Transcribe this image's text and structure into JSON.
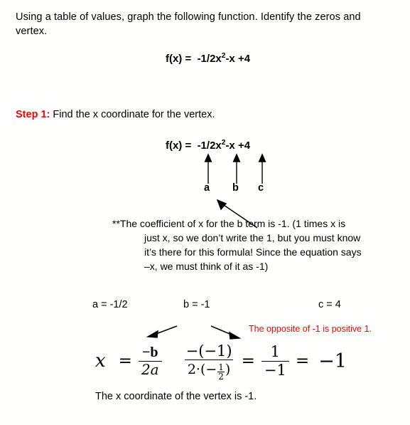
{
  "slide": {
    "background_color": "#fffffd",
    "accent_color": "#ff0000",
    "text_color": "#000000"
  },
  "intro": {
    "text": "Using a table of values, graph the following function.   Identify the zeros and vertex."
  },
  "equation_main": {
    "lhs": "f(x) =",
    "rhs_a": "-1/2x",
    "rhs_sq": "2",
    "rhs_b": "-x +4"
  },
  "step": {
    "label": "Step 1:",
    "text": "Find the x coordinate for the vertex."
  },
  "equation_second": {
    "lhs": "f(x) =",
    "rhs_a": "-1/2x",
    "rhs_sq": "2",
    "rhs_b": "-x +4"
  },
  "coefficient_labels": {
    "a": "a",
    "b": "b",
    "c": "c"
  },
  "note": {
    "line1": "**The coefficient of x for the b term is -1.  (1 times x is",
    "line2": "just x, so we don’t write the 1, but you must know",
    "line3": "it’s there for this formula!  Since the equation says",
    "line4": "–x, we must think of it as -1)"
  },
  "coefficient_values": {
    "a": "a = -1/2",
    "b": "b = -1",
    "c": "c = 4"
  },
  "red_annotation": {
    "text": "The opposite of -1 is positive 1."
  },
  "formula": {
    "variable": "x",
    "equals_1": "=",
    "frac1_num": "−b",
    "frac1_den": "2a",
    "frac2_num": "−(−1)",
    "frac2_den_lead": "2·(−",
    "frac2_den_mini_num": "1",
    "frac2_den_mini_den": "2",
    "frac2_den_tail": ")",
    "equals_2": "=",
    "frac3_num": "1",
    "frac3_den": "−1",
    "equals_3": "=",
    "result": "−1"
  },
  "closing": {
    "text": "The x coordinate of the vertex is -1."
  },
  "icons": {
    "up_arrow_a": "up-arrow-icon",
    "up_arrow_b": "up-arrow-icon",
    "up_arrow_c": "up-arrow-icon",
    "diagonal_arrow": "diagonal-arrow-icon",
    "pointer_left": "arrow-pointing-left-icon",
    "pointer_right": "arrow-pointing-right-icon"
  }
}
